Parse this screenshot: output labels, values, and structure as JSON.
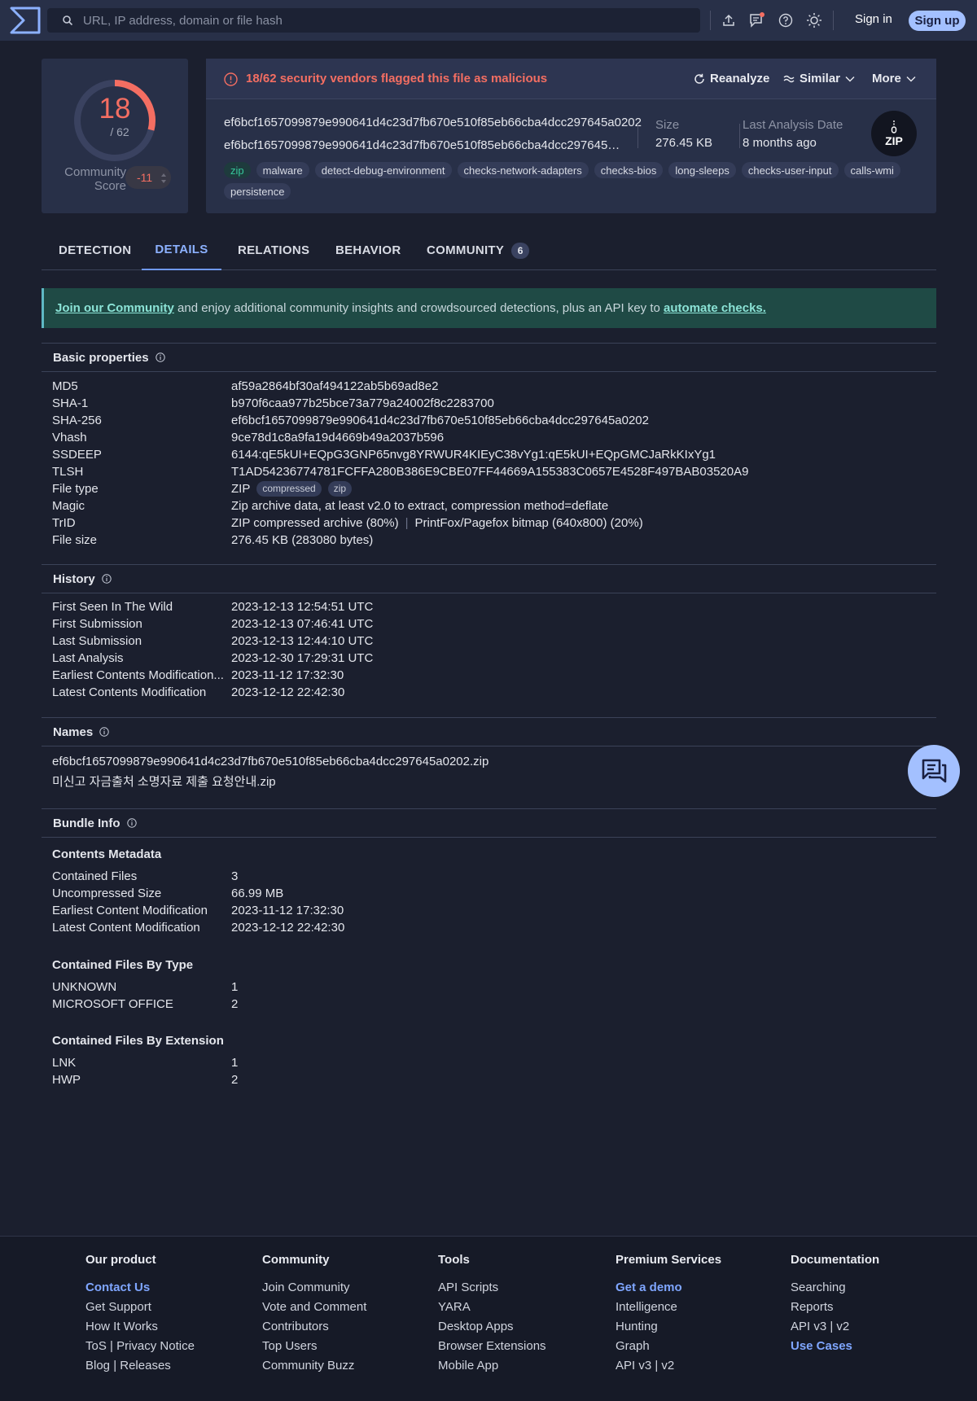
{
  "search": {
    "placeholder": "URL, IP address, domain or file hash"
  },
  "auth": {
    "signin": "Sign in",
    "signup": "Sign up"
  },
  "score": {
    "detections": "18",
    "total": "/ 62",
    "detections_value": 18,
    "total_value": 62,
    "community_label_line1": "Community",
    "community_label_line2": "Score",
    "community_value": "-11"
  },
  "alert": {
    "text": "18/62 security vendors flagged this file as malicious"
  },
  "actions": {
    "reanalyze": "Reanalyze",
    "similar": "Similar",
    "more": "More"
  },
  "file": {
    "hash": "ef6bcf1657099879e990641d4c23d7fb670e510f85eb66cba4dcc297645a0202",
    "name": "ef6bcf1657099879e990641d4c23d7fb670e510f85eb66cba4dcc297645a0202.zip",
    "size_label": "Size",
    "size_value": "276.45 KB",
    "date_label": "Last Analysis Date",
    "date_value": "8 months ago",
    "type_badge": "ZIP"
  },
  "tags": [
    "zip",
    "malware",
    "detect-debug-environment",
    "checks-network-adapters",
    "checks-bios",
    "long-sleeps",
    "checks-user-input",
    "calls-wmi",
    "persistence"
  ],
  "tabs": [
    {
      "label": "DETECTION"
    },
    {
      "label": "DETAILS"
    },
    {
      "label": "RELATIONS"
    },
    {
      "label": "BEHAVIOR"
    },
    {
      "label": "COMMUNITY",
      "count": "6"
    }
  ],
  "banner": {
    "link1": "Join our Community",
    "middle": " and enjoy additional community insights and crowdsourced detections, plus an API key to ",
    "link2": "automate checks."
  },
  "basic": {
    "title": "Basic properties",
    "md5": {
      "k": "MD5",
      "v": "af59a2864bf30af494122ab5b69ad8e2"
    },
    "sha1": {
      "k": "SHA-1",
      "v": "b970f6caa977b25bce73a779a24002f8c2283700"
    },
    "sha256": {
      "k": "SHA-256",
      "v": "ef6bcf1657099879e990641d4c23d7fb670e510f85eb66cba4dcc297645a0202"
    },
    "vhash": {
      "k": "Vhash",
      "v": "9ce78d1c8a9fa19d4669b49a2037b596"
    },
    "ssdeep": {
      "k": "SSDEEP",
      "v": "6144:qE5kUI+EQpG3GNP65nvg8YRWUR4KIEyC38vYg1:qE5kUI+EQpGMCJaRkKIxYg1"
    },
    "tlsh": {
      "k": "TLSH",
      "v": "T1AD54236774781FCFFA280B386E9CBE07FF44669A155383C0657E4528F497BAB03520A9"
    },
    "filetype": {
      "k": "File type",
      "v": "ZIP",
      "tag1": "compressed",
      "tag2": "zip"
    },
    "magic": {
      "k": "Magic",
      "v": "Zip archive data, at least v2.0 to extract, compression method=deflate"
    },
    "trid": {
      "k": "TrID",
      "v1": "ZIP compressed archive (80%)",
      "sep": "|",
      "v2": "PrintFox/Pagefox bitmap (640x800) (20%)"
    },
    "filesize": {
      "k": "File size",
      "v": "276.45 KB (283080 bytes)"
    }
  },
  "history": {
    "title": "History",
    "rows": [
      {
        "k": "First Seen In The Wild",
        "v": "2023-12-13 12:54:51 UTC"
      },
      {
        "k": "First Submission",
        "v": "2023-12-13 07:46:41 UTC"
      },
      {
        "k": "Last Submission",
        "v": "2023-12-13 12:44:10 UTC"
      },
      {
        "k": "Last Analysis",
        "v": "2023-12-30 17:29:31 UTC"
      },
      {
        "k": "Earliest Contents Modification...",
        "v": "2023-11-12 17:32:30"
      },
      {
        "k": "Latest Contents Modification",
        "v": "2023-12-12 22:42:30"
      }
    ]
  },
  "names": {
    "title": "Names",
    "list": [
      "ef6bcf1657099879e990641d4c23d7fb670e510f85eb66cba4dcc297645a0202.zip",
      "미신고 자금출처 소명자료 제출 요청안내.zip"
    ]
  },
  "bundle": {
    "title": "Bundle Info",
    "meta_title": "Contents Metadata",
    "meta": [
      {
        "k": "Contained Files",
        "v": "3"
      },
      {
        "k": "Uncompressed Size",
        "v": "66.99 MB"
      },
      {
        "k": "Earliest Content Modification",
        "v": "2023-11-12 17:32:30"
      },
      {
        "k": "Latest Content Modification",
        "v": "2023-12-12 22:42:30"
      }
    ],
    "bytype_title": "Contained Files By Type",
    "bytype": [
      {
        "k": "UNKNOWN",
        "v": "1"
      },
      {
        "k": "MICROSOFT OFFICE",
        "v": "2"
      }
    ],
    "byext_title": "Contained Files By Extension",
    "byext": [
      {
        "k": "LNK",
        "v": "1"
      },
      {
        "k": "HWP",
        "v": "2"
      }
    ]
  },
  "footer": {
    "product": {
      "title": "Our product",
      "links": [
        "Contact Us",
        "Get Support",
        "How It Works",
        "ToS | Privacy Notice",
        "Blog | Releases"
      ]
    },
    "community": {
      "title": "Community",
      "links": [
        "Join Community",
        "Vote and Comment",
        "Contributors",
        "Top Users",
        "Community Buzz"
      ]
    },
    "tools": {
      "title": "Tools",
      "links": [
        "API Scripts",
        "YARA",
        "Desktop Apps",
        "Browser Extensions",
        "Mobile App"
      ]
    },
    "premium": {
      "title": "Premium Services",
      "links": [
        "Get a demo",
        "Intelligence",
        "Hunting",
        "Graph",
        "API v3 | v2"
      ]
    },
    "docs": {
      "title": "Documentation",
      "links": [
        "Searching",
        "Reports",
        "API v3 | v2",
        "Use Cases"
      ]
    }
  },
  "colors": {
    "malicious": "#f46e62",
    "accent": "#a3c0ff",
    "link": "#7fa6ff",
    "banner_bg": "#1f4a45",
    "tag_green": "#36c79b"
  }
}
